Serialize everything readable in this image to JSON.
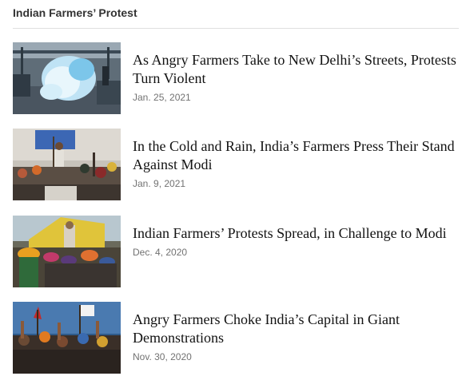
{
  "section": {
    "title": "Indian Farmers’ Protest"
  },
  "articles": [
    {
      "headline": "As Angry Farmers Take to New Delhi’s Streets, Protests Turn Violent",
      "date": "Jan. 25, 2021",
      "image": "tear-gas-protest-photo"
    },
    {
      "headline": "In the Cold and Rain, India’s Farmers Press Their Stand Against Modi",
      "date": "Jan. 9, 2021",
      "image": "farmers-rally-flag-photo"
    },
    {
      "headline": "Indian Farmers’ Protests Spread, in Challenge to Modi",
      "date": "Dec. 4, 2020",
      "image": "farmers-turbans-truck-photo"
    },
    {
      "headline": "Angry Farmers Choke India’s Capital in Giant Demonstrations",
      "date": "Nov. 30, 2020",
      "image": "crowd-raised-fists-photo"
    }
  ],
  "colors": {
    "headline": "#121212",
    "date": "#727272",
    "section_title": "#333333",
    "divider": "#dfdfdf"
  }
}
